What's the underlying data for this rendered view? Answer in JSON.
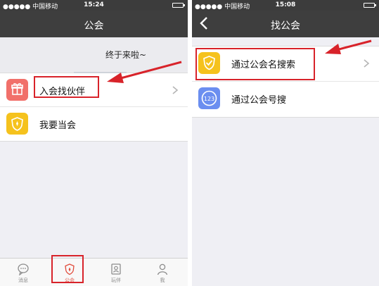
{
  "left": {
    "status": {
      "carrier": "●●●●● 中国移动",
      "time": "15:24"
    },
    "nav_title": "公会",
    "banner_text": "终于来啦~",
    "rows": [
      {
        "label": "入会找伙伴",
        "icon": "gift-icon",
        "color": "#f1706a"
      },
      {
        "label": "我要当会",
        "icon": "shield-icon",
        "color": "#f5c21d"
      }
    ],
    "tabs": [
      {
        "label": "消息",
        "icon": "chat-bubble-icon"
      },
      {
        "label": "公会",
        "icon": "guild-badge-icon"
      },
      {
        "label": "玩伴",
        "icon": "contact-card-icon"
      },
      {
        "label": "我",
        "icon": "person-icon"
      }
    ]
  },
  "right": {
    "status": {
      "carrier": "●●●●● 中国移动",
      "time": "15:08"
    },
    "nav_title": "找公会",
    "rows": [
      {
        "label": "通过公会名搜索",
        "icon": "shield-check-icon",
        "color": "#f5c21d"
      },
      {
        "label": "通过公会号搜",
        "icon": "number-123-icon",
        "badge": "123",
        "color": "#6b8ef0"
      }
    ]
  },
  "colors": {
    "accent_red": "#d8232a",
    "nav_dark": "#3e3e3e",
    "active_tab": "#e14b3b"
  }
}
